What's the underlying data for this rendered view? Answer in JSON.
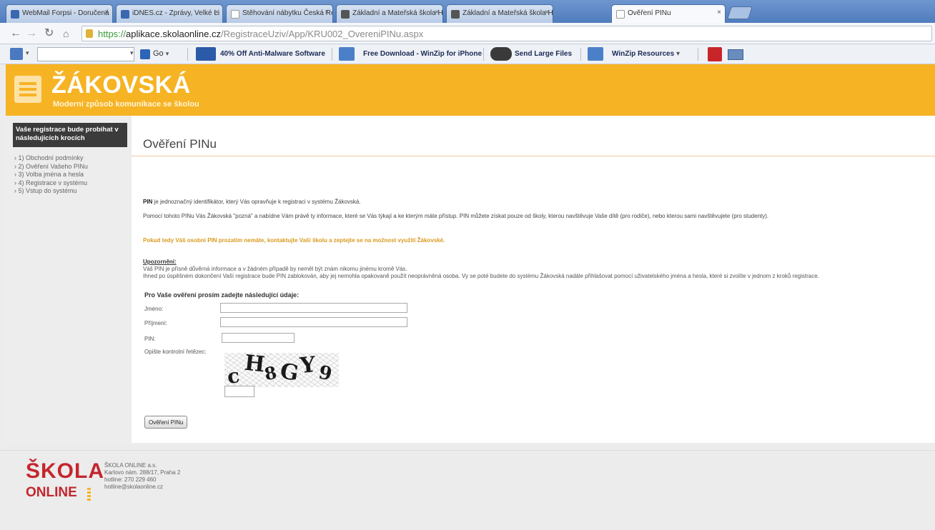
{
  "browser": {
    "tabs": [
      {
        "label": "WebMail Forpsi - Doručená"
      },
      {
        "label": "iDNES.cz - Zprávy, Velké Li"
      },
      {
        "label": "Stěhování nábytku Česká Rep"
      },
      {
        "label": "Základní a Mateřská škola H"
      },
      {
        "label": "Základní a Mateřská škola H"
      },
      {
        "label": "Ověření PINu"
      }
    ],
    "url": {
      "scheme": "https://",
      "host": "aplikace.skolaonline.cz",
      "path": "/RegistraceUziv/App/KRU002_OvereniPINu.aspx"
    },
    "toolbar": {
      "go_label": "Go",
      "items": [
        "40% Off Anti-Malware Software",
        "Free Download - WinZip for iPhone",
        "Send Large Files",
        "WinZip Resources"
      ]
    }
  },
  "header": {
    "brand": "ŽÁKOVSKÁ",
    "tagline": "Moderní způsob komunikace se školou"
  },
  "sidebar": {
    "heading": "Vaše registrace bude probíhat v následujících krocích",
    "steps": [
      "1) Obchodní podmínky",
      "2) Ověření Vašeho PINu",
      "3) Volba jména a hesla",
      "4) Registrace v systému",
      "5) Vstup do systému"
    ]
  },
  "main": {
    "title": "Ověření PINu",
    "pin_term": "PIN",
    "pin_definition": " je jednoznačný identifikátor, který Vás opravňuje k registraci v systému Žákovská.",
    "info_paragraph": "Pomocí tohoto PINu Vás Žákovská \"pozná\" a nabídne Vám právě ty informace, které se Vás týkají a ke kterým máte přístup. PIN můžete získat pouze od školy, kterou navštěvuje Vaše dítě (pro rodiče), nebo kterou sami navštěvujete (pro studenty).",
    "highlight_paragraph": "Pokud tedy Váš osobní PIN prozatím nemáte, kontaktujte Vaši školu a zeptejte se na možnost využití Žákovské.",
    "warning_heading": "Upozornění:",
    "warning_lines": [
      "Váš PIN je přísně důvěrná informace a v žádném případě by neměl být znám nikomu jinému kromě Vás.",
      "Ihned po úspěšném dokončení Vaší registrace bude PIN zablokován, aby jej nemohla opakovaně použít neoprávněná osoba. Vy se poté budete do systému Žákovská nadále přihlašovat pomocí uživatelského jména a hesla, které si zvolíte v jednom z kroků registrace."
    ],
    "form": {
      "heading": "Pro Vaše ověření prosím zadejte následující údaje:",
      "first_name_label": "Jméno:",
      "first_name_value": "",
      "last_name_label": "Příjmení:",
      "last_name_value": "",
      "pin_label": "PIN:",
      "pin_value": "",
      "captcha_label": "Opište kontrolní řetězec:",
      "captcha_text": "cH8GY9",
      "captcha_value": "",
      "submit_label": "Ověření PINu"
    }
  },
  "footer": {
    "logo_top": "ŠKOLA",
    "logo_bottom": "ONLINE",
    "company": "ŠKOLA ONLINE a.s.",
    "address": "Karlovo nám. 288/17, Praha 2",
    "hotline": "hotline: 270 229 460",
    "email": "hotline@skolaonline.cz"
  },
  "colors": {
    "brand_orange": "#f6b323",
    "brand_red": "#c4262e",
    "highlight_text": "#d99a1e"
  }
}
